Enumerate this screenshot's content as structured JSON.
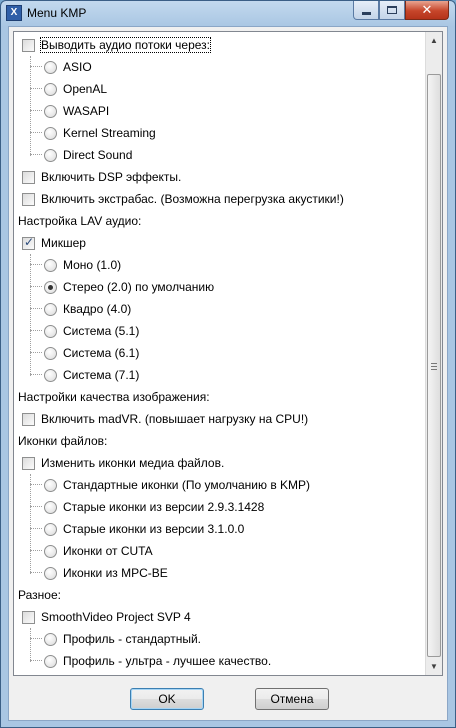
{
  "window": {
    "title": "Menu KMP",
    "icon_glyph": "X",
    "controls": {
      "minimize": "minimize-icon",
      "maximize": "maximize-icon",
      "close": "close-icon"
    }
  },
  "options": {
    "audio_output": {
      "label": "Выводить аудио потоки через:",
      "checked": false,
      "choices": [
        "ASIO",
        "OpenAL",
        "WASAPI",
        "Kernel Streaming",
        "Direct Sound"
      ]
    },
    "dsp": {
      "label": "Включить DSP эффекты.",
      "checked": false
    },
    "extrabass": {
      "label": "Включить экстрабас. (Возможна перегрузка акустики!)",
      "checked": false
    },
    "lav_header": "Настройка LAV аудио:",
    "mixer": {
      "label": "Микшер",
      "checked": true,
      "choices": [
        "Моно (1.0)",
        "Стерео (2.0) по умолчанию",
        "Квадро (4.0)",
        "Система (5.1)",
        "Система (6.1)",
        "Система (7.1)"
      ],
      "selected": "Стерео (2.0) по умолчанию"
    },
    "image_quality_header": "Настройки качества изображения:",
    "madvr": {
      "label": "Включить madVR. (повышает нагрузку на CPU!)",
      "checked": false
    },
    "file_icons_header": "Иконки файлов:",
    "change_icons": {
      "label": "Изменить иконки медиа файлов.",
      "checked": false,
      "choices": [
        "Стандартные иконки (По умолчанию в KMP)",
        "Старые иконки из версии 2.9.3.1428",
        "Старые иконки из версии 3.1.0.0",
        "Иконки от CUTA",
        "Иконки из MPC-BE"
      ]
    },
    "misc_header": "Разное:",
    "svp": {
      "label": "SmoothVideo Project SVP 4",
      "checked": false,
      "choices": [
        "Профиль - стандартный.",
        "Профиль - ультра - лучшее качество."
      ]
    }
  },
  "buttons": {
    "ok": "OK",
    "cancel": "Отмена"
  },
  "scrollbar": {
    "up": "scroll-up-arrow-icon",
    "down": "scroll-down-arrow-icon"
  }
}
